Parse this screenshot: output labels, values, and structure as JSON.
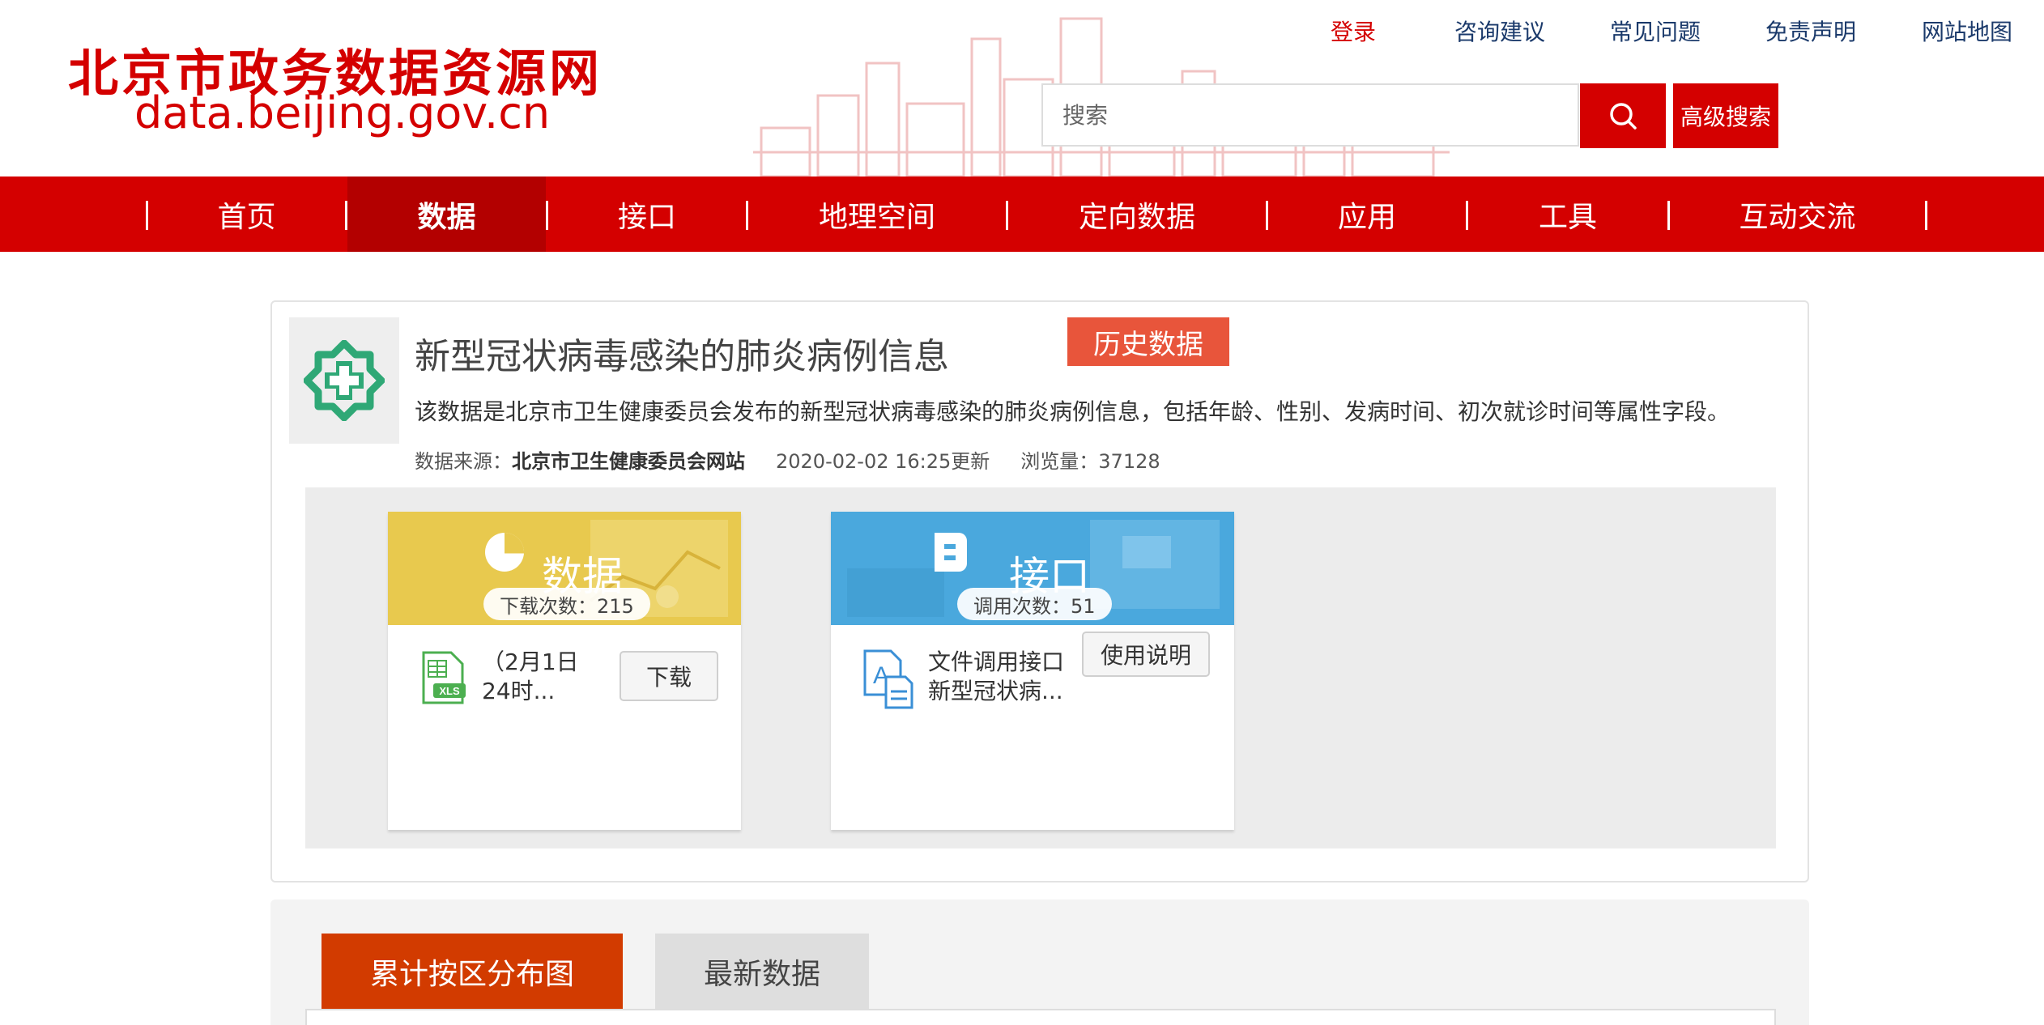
{
  "site": {
    "name_cn": "北京市政务数据资源网",
    "domain": "data.beijing.gov.cn"
  },
  "top_links": [
    "登录",
    "咨询建议",
    "常见问题",
    "免责声明",
    "网站地图"
  ],
  "search": {
    "placeholder": "搜索",
    "advanced_label": "高级搜索"
  },
  "nav": {
    "items": [
      "首页",
      "数据",
      "接口",
      "地理空间",
      "定向数据",
      "应用",
      "工具",
      "互动交流"
    ],
    "active": "数据"
  },
  "dataset": {
    "title": "新型冠状病毒感染的肺炎病例信息",
    "history_button": "历史数据",
    "description": "该数据是北京市卫生健康委员会发布的新型冠状病毒感染的肺炎病例信息，包括年龄、性别、发病时间、初次就诊时间等属性字段。",
    "source_label": "数据来源：",
    "source_value": "北京市卫生健康委员会网站",
    "updated": "2020-02-02 16:25更新",
    "views": "浏览量：37128"
  },
  "data_card": {
    "title": "数据",
    "count": "下载次数：215",
    "file_line1": "（2月1日",
    "file_line2": "24时...",
    "file_icon": "xls-file-icon",
    "button": "下载"
  },
  "api_card": {
    "title": "接口",
    "count": "调用次数：51",
    "file_line1": "文件调用接口",
    "file_line2": "新型冠状病...",
    "file_icon": "api-doc-icon",
    "button": "使用说明"
  },
  "tabs": [
    "累计按区分布图",
    "最新数据"
  ],
  "colors": {
    "brand_red": "#d40000",
    "nav_active": "#b30000",
    "history_orange": "#e8553b",
    "tab_active": "#d23b00",
    "data_yellow": "#e8c94e",
    "api_blue": "#4aa8dd",
    "logo_green": "#2fa876"
  }
}
